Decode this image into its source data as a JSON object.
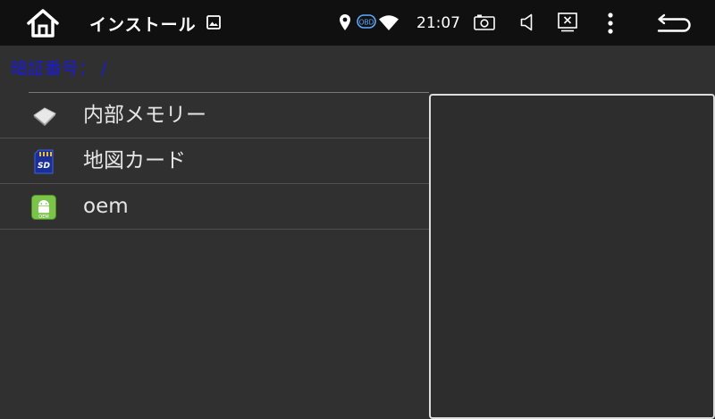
{
  "status_bar": {
    "title": "インストール",
    "obd_label": "OBD",
    "time": "21:07",
    "icons": {
      "home": "home-icon",
      "gallery": "image-icon",
      "location": "location-pin-icon",
      "obd": "obd-icon",
      "wifi": "wifi-icon",
      "camera": "camera-icon",
      "volume": "volume-icon",
      "screen_off": "screen-off-icon",
      "menu": "more-vert-icon",
      "back": "back-arrow-icon"
    }
  },
  "path": {
    "label": "暗証番号： /"
  },
  "storage_list": [
    {
      "label": "内部メモリー",
      "icon": "internal-memory-icon"
    },
    {
      "label": "地図カード",
      "icon": "sd-card-icon",
      "icon_text": "SD"
    },
    {
      "label": "oem",
      "icon": "android-oem-icon",
      "icon_text": "OEM"
    }
  ],
  "colors": {
    "status_bar_bg": "#101010",
    "content_bg": "#303030",
    "path_text": "#1a1ad8",
    "row_text": "#e6e6e6",
    "divider": "#505050",
    "panel_border": "#dcdcdc"
  }
}
